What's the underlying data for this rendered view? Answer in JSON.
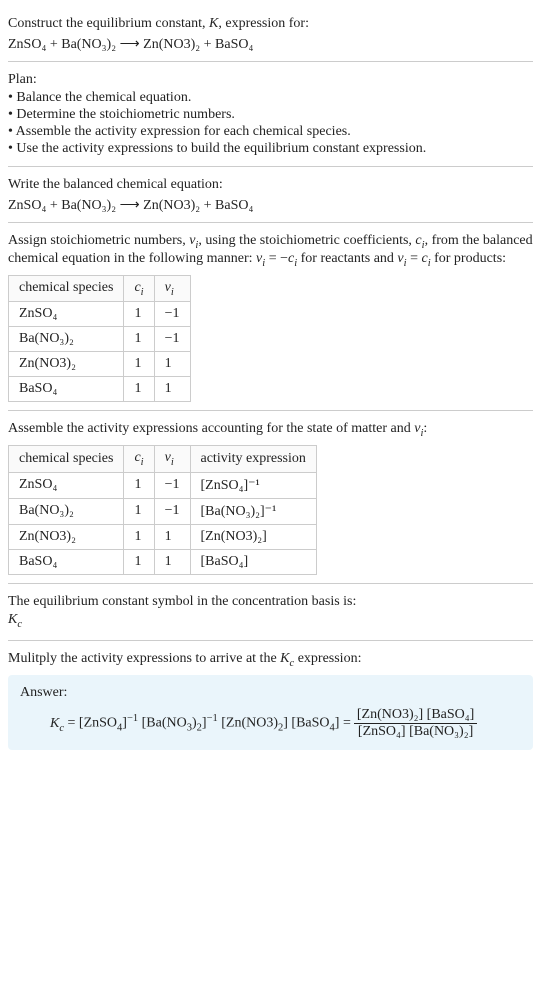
{
  "prompt": {
    "line1": "Construct the equilibrium constant, K, expression for:",
    "equation": "ZnSO₄ + Ba(NO₃)₂ ⟶ Zn(NO3)₂ + BaSO₄"
  },
  "plan": {
    "heading": "Plan:",
    "items": [
      "• Balance the chemical equation.",
      "• Determine the stoichiometric numbers.",
      "• Assemble the activity expression for each chemical species.",
      "• Use the activity expressions to build the equilibrium constant expression."
    ]
  },
  "balanced": {
    "heading": "Write the balanced chemical equation:",
    "equation": "ZnSO₄ + Ba(NO₃)₂ ⟶ Zn(NO3)₂ + BaSO₄"
  },
  "stoich": {
    "heading": "Assign stoichiometric numbers, νᵢ, using the stoichiometric coefficients, cᵢ, from the balanced chemical equation in the following manner: νᵢ = −cᵢ for reactants and νᵢ = cᵢ for products:",
    "headers": {
      "species": "chemical species",
      "ci": "cᵢ",
      "vi": "νᵢ"
    },
    "rows": [
      {
        "species": "ZnSO₄",
        "ci": "1",
        "vi": "−1"
      },
      {
        "species": "Ba(NO₃)₂",
        "ci": "1",
        "vi": "−1"
      },
      {
        "species": "Zn(NO3)₂",
        "ci": "1",
        "vi": "1"
      },
      {
        "species": "BaSO₄",
        "ci": "1",
        "vi": "1"
      }
    ]
  },
  "activity": {
    "heading": "Assemble the activity expressions accounting for the state of matter and νᵢ:",
    "headers": {
      "species": "chemical species",
      "ci": "cᵢ",
      "vi": "νᵢ",
      "act": "activity expression"
    },
    "rows": [
      {
        "species": "ZnSO₄",
        "ci": "1",
        "vi": "−1",
        "act": "[ZnSO₄]⁻¹"
      },
      {
        "species": "Ba(NO₃)₂",
        "ci": "1",
        "vi": "−1",
        "act": "[Ba(NO₃)₂]⁻¹"
      },
      {
        "species": "Zn(NO3)₂",
        "ci": "1",
        "vi": "1",
        "act": "[Zn(NO3)₂]"
      },
      {
        "species": "BaSO₄",
        "ci": "1",
        "vi": "1",
        "act": "[BaSO₄]"
      }
    ]
  },
  "symbol": {
    "heading": "The equilibrium constant symbol in the concentration basis is:",
    "value": "K𝑐"
  },
  "multiply": {
    "heading": "Mulitply the activity expressions to arrive at the K𝑐 expression:"
  },
  "answer": {
    "label": "Answer:",
    "lhs": "K𝑐 = [ZnSO₄]⁻¹ [Ba(NO₃)₂]⁻¹ [Zn(NO3)₂] [BaSO₄] = ",
    "frac_num": "[Zn(NO3)₂] [BaSO₄]",
    "frac_den": "[ZnSO₄] [Ba(NO₃)₂]"
  }
}
